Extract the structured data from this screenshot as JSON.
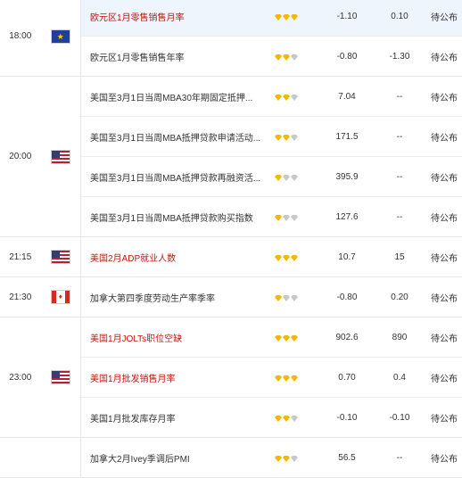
{
  "colors": {
    "highlight_row": "#eef5fd",
    "red_text": "#c0170f",
    "star_gold": "#f5b800",
    "star_grey": "#c8c8c8"
  },
  "groups": [
    {
      "time": "18:00",
      "flag": "eu-flag",
      "rows": [
        {
          "name": "欧元区1月零售销售月率",
          "red": true,
          "stars": 3,
          "prev": "-1.10",
          "forecast": "0.10",
          "actual": "待公布"
        },
        {
          "name": "欧元区1月零售销售年率",
          "red": false,
          "stars": 2,
          "prev": "-0.80",
          "forecast": "-1.30",
          "actual": "待公布"
        }
      ]
    },
    {
      "time": "20:00",
      "flag": "us-flag",
      "rows": [
        {
          "name": "美国至3月1日当周MBA30年期固定抵押...",
          "red": false,
          "stars": 2,
          "prev": "7.04",
          "forecast": "--",
          "actual": "待公布"
        },
        {
          "name": "美国至3月1日当周MBA抵押贷款申请活动...",
          "red": false,
          "stars": 2,
          "prev": "171.5",
          "forecast": "--",
          "actual": "待公布"
        },
        {
          "name": "美国至3月1日当周MBA抵押贷款再融资活...",
          "red": false,
          "stars": 1,
          "prev": "395.9",
          "forecast": "--",
          "actual": "待公布"
        },
        {
          "name": "美国至3月1日当周MBA抵押贷款购买指数",
          "red": false,
          "stars": 1,
          "prev": "127.6",
          "forecast": "--",
          "actual": "待公布"
        }
      ]
    },
    {
      "time": "21:15",
      "flag": "us-flag",
      "rows": [
        {
          "name": "美国2月ADP就业人数",
          "red": true,
          "stars": 3,
          "prev": "10.7",
          "forecast": "15",
          "actual": "待公布"
        }
      ]
    },
    {
      "time": "21:30",
      "flag": "ca-flag",
      "rows": [
        {
          "name": "加拿大第四季度劳动生产率季率",
          "red": false,
          "stars": 1,
          "prev": "-0.80",
          "forecast": "0.20",
          "actual": "待公布"
        }
      ]
    },
    {
      "time": "23:00",
      "flag": "us-flag",
      "rows": [
        {
          "name": "美国1月JOLTs职位空缺",
          "red": true,
          "stars": 3,
          "prev": "902.6",
          "forecast": "890",
          "actual": "待公布"
        },
        {
          "name": "美国1月批发销售月率",
          "red": true,
          "stars": 3,
          "prev": "0.70",
          "forecast": "0.4",
          "actual": "待公布"
        },
        {
          "name": "美国1月批发库存月率",
          "red": false,
          "stars": 2,
          "prev": "-0.10",
          "forecast": "-0.10",
          "actual": "待公布"
        }
      ]
    },
    {
      "time": "",
      "flag": "",
      "rows": [
        {
          "name": "加拿大2月Ivey季调后PMI",
          "red": false,
          "stars": 2,
          "prev": "56.5",
          "forecast": "--",
          "actual": "待公布"
        }
      ]
    }
  ]
}
